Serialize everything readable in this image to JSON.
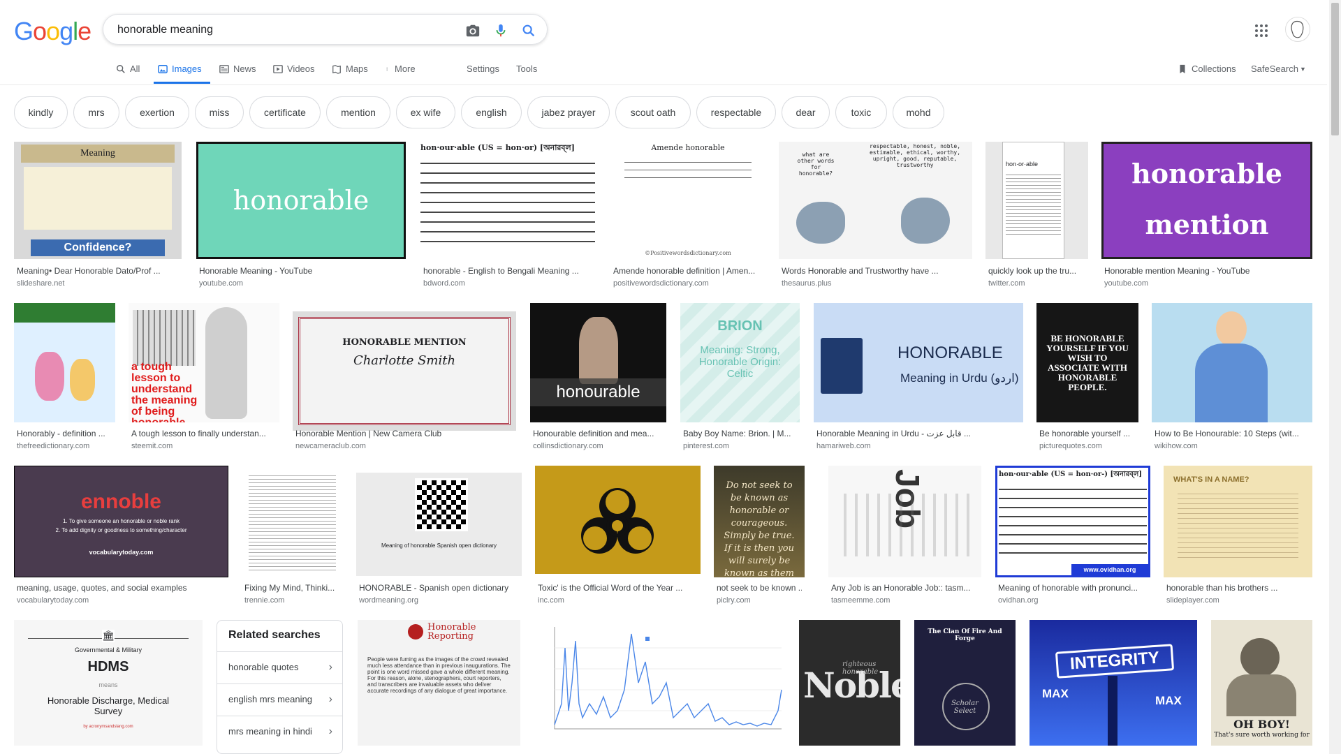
{
  "logo": {
    "g1": "G",
    "o1": "o",
    "o2": "o",
    "g2": "g",
    "l": "l",
    "e": "e"
  },
  "search": {
    "query": "honorable meaning"
  },
  "tabs": {
    "all": "All",
    "images": "Images",
    "news": "News",
    "videos": "Videos",
    "maps": "Maps",
    "more": "More",
    "settings": "Settings",
    "tools": "Tools"
  },
  "right": {
    "collections": "Collections",
    "safesearch": "SafeSearch"
  },
  "chips": [
    "kindly",
    "mrs",
    "exertion",
    "miss",
    "certificate",
    "mention",
    "ex wife",
    "english",
    "jabez prayer",
    "scout oath",
    "respectable",
    "dear",
    "toxic",
    "mohd"
  ],
  "results": [
    {
      "cap": "Meaning• Dear Honorable Dato/Prof ...",
      "src": "slideshare.net",
      "img": {
        "title": "Meaning",
        "footer": "Confidence?"
      }
    },
    {
      "cap": "Honorable Meaning - YouTube",
      "src": "youtube.com",
      "img": {
        "word": "honorable"
      }
    },
    {
      "cap": "honorable - English to Bengali Meaning ...",
      "src": "bdword.com",
      "img": {
        "head": "hon·our·able (US = hon·or) [অনারব্‌ল]"
      }
    },
    {
      "cap": "Amende honorable definition | Amen...",
      "src": "positivewordsdictionary.com",
      "img": {
        "head": "Amende honorable",
        "foot": "©Positivewordsdictionary.com"
      }
    },
    {
      "cap": "Words Honorable and Trustworthy have ...",
      "src": "thesaurus.plus",
      "img": {
        "q": "what are other words for honorable?",
        "a": "respectable, honest, noble, estimable, ethical, worthy, upright, good, reputable, trustworthy"
      }
    },
    {
      "cap": "quickly look up the tru...",
      "src": "twitter.com",
      "img": {
        "t": "hon·or·able"
      }
    },
    {
      "cap": "Honorable mention Meaning - YouTube",
      "src": "youtube.com",
      "img": {
        "l1": "honorable",
        "l2": "mention"
      }
    },
    {
      "cap": "Honorably - definition ...",
      "src": "thefreedictionary.com",
      "img": {}
    },
    {
      "cap": "A tough lesson to finally understan...",
      "src": "steemit.com",
      "img": {
        "t": "a tough lesson to understand the meaning of being honorable"
      }
    },
    {
      "cap": "Honorable Mention | New Camera Club",
      "src": "newcameraclub.com",
      "img": {
        "t1": "HONORABLE MENTION",
        "t2": "Charlotte Smith"
      }
    },
    {
      "cap": "Honourable definition and mea...",
      "src": "collinsdictionary.com",
      "img": {
        "t": "honourable"
      }
    },
    {
      "cap": "Baby Boy Name: Brion. | M...",
      "src": "pinterest.com",
      "img": {
        "t1": "BRION",
        "t2": "Meaning: Strong, Honorable Origin: Celtic"
      }
    },
    {
      "cap": "Honorable Meaning in Urdu - قابل عزت ...",
      "src": "hamariweb.com",
      "img": {
        "t1": "HONORABLE",
        "t2": "Meaning in Urdu (اردو)"
      }
    },
    {
      "cap": "Be honorable yourself ...",
      "src": "picturequotes.com",
      "img": {
        "t": "BE HONORABLE YOURSELF IF YOU WISH TO ASSOCIATE WITH HONORABLE PEOPLE."
      }
    },
    {
      "cap": "How to Be Honourable: 10 Steps (wit...",
      "src": "wikihow.com",
      "img": {}
    },
    {
      "cap": "meaning, usage, quotes, and social examples",
      "src": "vocabularytoday.com",
      "img": {
        "t1": "ennoble",
        "t2": "1. To give someone an honorable or noble rank",
        "t3": "2. To add dignity or goodness to something/character",
        "t4": "vocabularytoday.com"
      }
    },
    {
      "cap": "Fixing My Mind, Thinki...",
      "src": "trennie.com",
      "img": {}
    },
    {
      "cap": "HONORABLE - Spanish open dictionary",
      "src": "wordmeaning.org",
      "img": {
        "t": "Meaning of honorable Spanish open dictionary"
      }
    },
    {
      "cap": "Toxic' is the Official Word of the Year ...",
      "src": "inc.com",
      "img": {}
    },
    {
      "cap": "not seek to be known ...",
      "src": "piclry.com",
      "img": {
        "t": "Do not seek to be known as honorable or courageous. Simply be true. If it is then you will surely be known as them all."
      }
    },
    {
      "cap": "Any Job is an Honorable Job:: tasm...",
      "src": "tasmeemme.com",
      "img": {
        "t": "Job"
      }
    },
    {
      "cap": "Meaning of honorable with pronunci...",
      "src": "ovidhan.org",
      "img": {
        "head": "hon·our·able (US = hon·or-) [অনারব্‌ল]",
        "foot": "www.ovidhan.org"
      }
    },
    {
      "cap": "honorable than his brothers ...",
      "src": "slideplayer.com",
      "img": {
        "t": "WHAT'S IN A NAME?"
      }
    },
    {
      "img": {
        "t1": "Governmental & Military",
        "t2": "HDMS",
        "t3": "means",
        "t4": "Honorable Discharge, Medical Survey",
        "t5": "by acronymsandslang.com"
      }
    },
    {
      "img": {
        "t1": "Honorable Reporting",
        "t2": "People were fuming as the images of the crowd revealed much less attendance than in previous inaugurations. The point is one word missed gave a whole different meaning. For this reason, alone, stenographers, court reporters, and transcribers are invaluable assets who deliver accurate recordings of any dialogue of great importance."
      }
    },
    {
      "img": {}
    },
    {
      "img": {
        "t1": "Noble",
        "t2": "righteous honorable"
      }
    },
    {
      "img": {
        "t1": "The Clan Of Fire And Forge",
        "t2": "Scholar Select"
      }
    },
    {
      "img": {
        "t1": "INTEGRITY",
        "t2": "MAX",
        "t3": "MAX"
      }
    },
    {
      "img": {
        "t1": "OH BOY!",
        "t2": "That's sure worth working for"
      }
    }
  ],
  "related": {
    "title": "Related searches",
    "items": [
      "honorable quotes",
      "english mrs meaning",
      "mrs meaning in hindi"
    ]
  }
}
